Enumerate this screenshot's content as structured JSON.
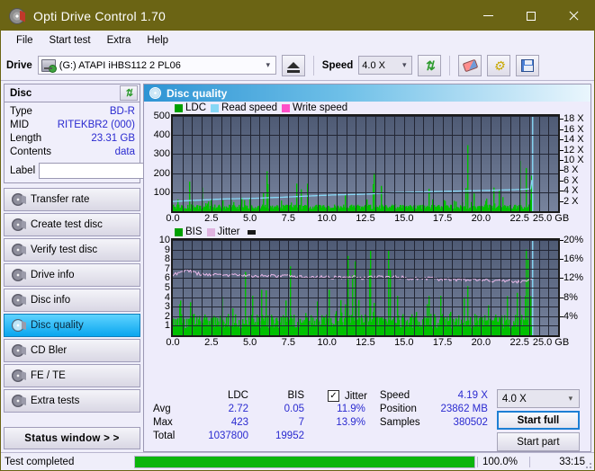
{
  "window": {
    "title": "Opti Drive Control 1.70",
    "icon": "disc-icon",
    "minimize": "minimize-icon",
    "maximize": "maximize-icon",
    "close": "close-icon"
  },
  "menu": {
    "items": [
      {
        "label": "File"
      },
      {
        "label": "Start test"
      },
      {
        "label": "Extra"
      },
      {
        "label": "Help"
      }
    ]
  },
  "toolbar": {
    "drive_label": "Drive",
    "drive_value": "(G:)  ATAPI iHBS112  2 PL06",
    "eject_icon": "eject-icon",
    "speed_label": "Speed",
    "speed_value": "4.0 X",
    "refresh_icon": "refresh-icon",
    "eraser_icon": "eraser-icon",
    "tools_icon": "wrench-icon",
    "save_icon": "save-icon"
  },
  "sidebar": {
    "disc_panel": {
      "title": "Disc",
      "refresh_icon": "refresh-icon",
      "rows": [
        {
          "key": "Type",
          "value": "BD-R"
        },
        {
          "key": "MID",
          "value": "RITEKBR2 (000)"
        },
        {
          "key": "Length",
          "value": "23.31 GB"
        },
        {
          "key": "Contents",
          "value": "data"
        }
      ],
      "label_key": "Label",
      "label_value": "",
      "label_placeholder": "",
      "disc_icon": "disc-icon"
    },
    "nav": [
      {
        "label": "Transfer rate",
        "icon": "disc-test-icon",
        "active": false
      },
      {
        "label": "Create test disc",
        "icon": "disc-burn-icon",
        "active": false
      },
      {
        "label": "Verify test disc",
        "icon": "disc-verify-icon",
        "active": false
      },
      {
        "label": "Drive info",
        "icon": "drive-info-icon",
        "active": false
      },
      {
        "label": "Disc info",
        "icon": "disc-info-icon",
        "active": false
      },
      {
        "label": "Disc quality",
        "icon": "disc-quality-icon",
        "active": true
      },
      {
        "label": "CD Bler",
        "icon": "cd-bler-icon",
        "active": false
      },
      {
        "label": "FE / TE",
        "icon": "fe-te-icon",
        "active": false
      },
      {
        "label": "Extra tests",
        "icon": "extra-tests-icon",
        "active": false
      }
    ],
    "status_window_button": "Status window > >"
  },
  "panel": {
    "title": "Disc quality",
    "icon": "disc-quality-icon"
  },
  "stats": {
    "columns": [
      "LDC",
      "BIS"
    ],
    "rows": [
      {
        "name": "Avg",
        "ldc": "2.72",
        "bis": "0.05",
        "jitter": "11.9%"
      },
      {
        "name": "Max",
        "ldc": "423",
        "bis": "7",
        "jitter": "13.9%"
      },
      {
        "name": "Total",
        "ldc": "1037800",
        "bis": "19952",
        "jitter": ""
      }
    ],
    "jitter_label": "Jitter",
    "jitter_checked": true,
    "jitter_checkmark": "✓",
    "speed_key": "Speed",
    "speed_value": "4.19 X",
    "position_key": "Position",
    "position_value": "23862 MB",
    "samples_key": "Samples",
    "samples_value": "380502",
    "speed_select": "4.0 X",
    "start_full": "Start full",
    "start_part": "Start part"
  },
  "statusbar": {
    "message": "Test completed",
    "percent_label": "100.0%",
    "percent_value": 100,
    "elapsed": "33:15",
    "progress_color": "#0bb50b"
  },
  "chart_data": [
    {
      "id": "disc-quality-ldc-chart",
      "type": "line",
      "title": "",
      "xlabel": "GB",
      "ylabel": "",
      "xlim": [
        0.0,
        25.0
      ],
      "xticks": [
        0.0,
        2.5,
        5.0,
        7.5,
        10.0,
        12.5,
        15.0,
        17.5,
        20.0,
        22.5,
        25.0
      ],
      "xticklabels": [
        "0.0",
        "2.5",
        "5.0",
        "7.5",
        "10.0",
        "12.5",
        "15.0",
        "17.5",
        "20.0",
        "22.5",
        "25.0 GB"
      ],
      "ylim": [
        0,
        500
      ],
      "yticks": [
        100,
        200,
        300,
        400,
        500
      ],
      "yticklabels": [
        "100",
        "200",
        "300",
        "400",
        "500"
      ],
      "y2lim": [
        0,
        18.6
      ],
      "y2ticks": [
        2,
        4,
        6,
        8,
        10,
        12,
        14,
        16,
        18
      ],
      "y2ticklabels": [
        "2 X",
        "4 X",
        "6 X",
        "8 X",
        "10 X",
        "12 X",
        "14 X",
        "16 X",
        "18 X"
      ],
      "grid": true,
      "legend": [
        {
          "name": "LDC",
          "color": "#00a000"
        },
        {
          "name": "Read speed",
          "color": "#87d7f5"
        },
        {
          "name": "Write speed",
          "color": "#ff4fc8"
        }
      ],
      "series": [
        {
          "name": "Read speed",
          "color": "#87d7f5",
          "axis": "right",
          "x": [
            0.0,
            0.6,
            1.2,
            1.9,
            2.6,
            3.3,
            4.1,
            4.9,
            5.6,
            6.2,
            6.9,
            7.6,
            8.3,
            9.0,
            9.8,
            10.6,
            11.4,
            12.2,
            13.0,
            13.7,
            14.5,
            15.3,
            16.0,
            16.7,
            17.3,
            18.0,
            18.7,
            19.4,
            20.1,
            20.8,
            21.5,
            22.2,
            22.9,
            23.3,
            23.35
          ],
          "y": [
            1.9,
            2.0,
            2.1,
            2.2,
            2.3,
            2.4,
            2.45,
            2.5,
            2.55,
            2.65,
            2.7,
            2.8,
            2.9,
            3.0,
            3.1,
            3.2,
            3.25,
            3.3,
            3.4,
            3.55,
            3.65,
            3.7,
            3.75,
            3.8,
            3.85,
            3.9,
            3.95,
            4.0,
            4.05,
            4.1,
            4.15,
            4.2,
            4.3,
            4.4,
            18.6
          ]
        },
        {
          "name": "LDC",
          "color": "#00c000",
          "axis": "left",
          "description": "Dense green spike band, baseline ~20-40, frequent spikes to 60-160, notable peaks at 6.1GB=423, 13.0GB=411, 19.1GB=350, 22.5GB=345, 22.9GB=240, 23.3GB=195",
          "baseline": 25,
          "peaks": [
            {
              "x": 1.05,
              "y": 160
            },
            {
              "x": 6.1,
              "y": 423
            },
            {
              "x": 8.7,
              "y": 155
            },
            {
              "x": 13.0,
              "y": 411
            },
            {
              "x": 16.6,
              "y": 152
            },
            {
              "x": 19.1,
              "y": 350
            },
            {
              "x": 20.3,
              "y": 145
            },
            {
              "x": 20.8,
              "y": 140
            },
            {
              "x": 21.4,
              "y": 130
            },
            {
              "x": 22.5,
              "y": 345
            },
            {
              "x": 22.9,
              "y": 240
            },
            {
              "x": 23.25,
              "y": 195
            }
          ]
        }
      ]
    },
    {
      "id": "disc-quality-bis-chart",
      "type": "line",
      "title": "",
      "xlabel": "GB",
      "ylabel": "",
      "xlim": [
        0.0,
        25.0
      ],
      "xticks": [
        0.0,
        2.5,
        5.0,
        7.5,
        10.0,
        12.5,
        15.0,
        17.5,
        20.0,
        22.5,
        25.0
      ],
      "xticklabels": [
        "0.0",
        "2.5",
        "5.0",
        "7.5",
        "10.0",
        "12.5",
        "15.0",
        "17.5",
        "20.0",
        "22.5",
        "25.0 GB"
      ],
      "ylim": [
        0,
        10
      ],
      "yticks": [
        1,
        2,
        3,
        4,
        5,
        6,
        7,
        8,
        9,
        10
      ],
      "yticklabels": [
        "1",
        "2",
        "3",
        "4",
        "5",
        "6",
        "7",
        "8",
        "9",
        "10"
      ],
      "y2lim": [
        0,
        20
      ],
      "y2ticks": [
        4,
        8,
        12,
        16,
        20
      ],
      "y2ticklabels": [
        "4%",
        "8%",
        "12%",
        "16%",
        "20%"
      ],
      "grid": true,
      "legend": [
        {
          "name": "BIS",
          "color": "#00a000"
        },
        {
          "name": "Jitter",
          "color": "#e0b4e0"
        }
      ],
      "series": [
        {
          "name": "Jitter",
          "color": "#e8b8e8",
          "axis": "right",
          "x": [
            0.0,
            0.5,
            1.0,
            1.3,
            1.7,
            2.2,
            2.8,
            3.4,
            4.0,
            4.6,
            5.2,
            5.8,
            6.5,
            7.2,
            7.9,
            8.6,
            9.3,
            10.0,
            10.8,
            11.6,
            12.4,
            13.2,
            14.0,
            14.8,
            15.6,
            16.4,
            17.2,
            18.0,
            18.8,
            19.6,
            20.4,
            21.2,
            22.0,
            22.6,
            23.2
          ],
          "y": [
            12.8,
            13.2,
            13.6,
            13.3,
            12.9,
            12.8,
            12.7,
            12.7,
            12.6,
            12.6,
            12.5,
            12.5,
            12.4,
            12.4,
            12.3,
            12.3,
            12.3,
            12.2,
            12.2,
            12.2,
            12.1,
            12.1,
            12.2,
            12.1,
            12.0,
            11.9,
            11.8,
            11.7,
            11.7,
            11.6,
            11.5,
            11.4,
            11.3,
            11.3,
            11.6
          ]
        },
        {
          "name": "BIS",
          "color": "#00c000",
          "axis": "left",
          "description": "Dense green band with baseline ~1-2, frequent spikes to 2.5-3.5, peaks at 6.0=7, 13.0=7, 16.6=5.3, 19.1=5.2, 22.5=5.4, 23.0=5.3",
          "baseline": 1.6,
          "peaks": [
            {
              "x": 1.15,
              "y": 3.0
            },
            {
              "x": 6.0,
              "y": 7.0
            },
            {
              "x": 8.6,
              "y": 3.2
            },
            {
              "x": 13.0,
              "y": 7.0
            },
            {
              "x": 16.6,
              "y": 5.3
            },
            {
              "x": 19.1,
              "y": 5.2
            },
            {
              "x": 20.3,
              "y": 3.4
            },
            {
              "x": 21.3,
              "y": 3.2
            },
            {
              "x": 22.5,
              "y": 5.4
            },
            {
              "x": 22.85,
              "y": 5.3
            },
            {
              "x": 23.2,
              "y": 5.2
            }
          ]
        }
      ]
    }
  ]
}
